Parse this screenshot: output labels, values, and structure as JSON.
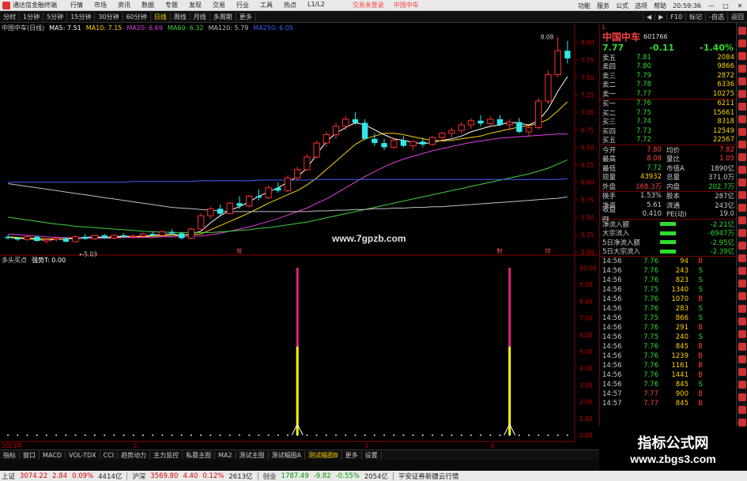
{
  "title_bar": {
    "app_name": "通达信金融终端",
    "menu": [
      "行情",
      "市场",
      "资讯",
      "数据",
      "专题",
      "发现",
      "交易",
      "行业",
      "工具",
      "热点",
      "L1/L2"
    ],
    "trade_text": "交易未登录",
    "stock_text": "中国中车",
    "right_menu": [
      "功能",
      "服务",
      "公式",
      "选项",
      "帮助"
    ],
    "time": "20:59:36",
    "win_buttons": [
      "—",
      "□",
      "✕"
    ]
  },
  "toolbar": {
    "periods": [
      "分时",
      "1分钟",
      "5分钟",
      "15分钟",
      "30分钟",
      "60分钟",
      "日线",
      "周线",
      "月线",
      "多周期",
      "更多"
    ],
    "active_period": "日线",
    "tools": [
      "◀",
      "▶",
      "F10",
      "标记",
      "-自选",
      "返回"
    ]
  },
  "indicators": {
    "main": [
      {
        "label": "中国中车(日线)",
        "color": "#cccccc"
      },
      {
        "label": "MA5: 7.51",
        "color": "#ffffff"
      },
      {
        "label": "MA10: 7.15",
        "color": "#ffd200"
      },
      {
        "label": "MA20: 6.69",
        "color": "#e040e0"
      },
      {
        "label": "MA60: 6.32",
        "color": "#40d040"
      },
      {
        "label": "MA120: 5.79",
        "color": "#c0c0c0"
      },
      {
        "label": "MA250: 6.05",
        "color": "#4060ff"
      }
    ],
    "sub": [
      {
        "label": "多头买点",
        "color": "#cccccc"
      },
      {
        "label": "强势T: 0.00",
        "color": "#ffffff"
      }
    ]
  },
  "watermark": "www.7gpzb.com",
  "chart_data": [
    {
      "type": "candlestick",
      "title": "中国中车(日线)",
      "price_axis_ticks": [
        8.0,
        7.75,
        7.5,
        7.25,
        7.0,
        6.75,
        6.5,
        6.25,
        6.0,
        5.75,
        5.5,
        5.25,
        5.0
      ],
      "ylim": [
        4.98,
        8.12
      ],
      "max_label": "8.08",
      "min_label": "5.03",
      "markers": [
        "增",
        "制",
        "持"
      ],
      "series": [
        {
          "name": "MA5",
          "color": "#ffffff",
          "values": [
            5.21,
            5.2,
            5.19,
            5.18,
            5.17,
            5.18,
            5.19,
            5.2,
            5.21,
            5.22,
            5.21,
            5.22,
            5.23,
            5.22,
            5.23,
            5.24,
            5.25,
            5.26,
            5.24,
            5.26,
            5.3,
            5.42,
            5.52,
            5.6,
            5.65,
            5.72,
            5.8,
            5.86,
            5.92,
            6.0,
            6.08,
            6.2,
            6.4,
            6.58,
            6.7,
            6.78,
            6.85,
            6.82,
            6.75,
            6.68,
            6.62,
            6.6,
            6.57,
            6.55,
            6.57,
            6.6,
            6.62,
            6.66,
            6.72,
            6.76,
            6.8,
            6.82,
            6.86,
            6.84,
            6.82,
            6.88,
            7.05,
            7.3,
            7.51
          ]
        },
        {
          "name": "MA10",
          "color": "#ffd200",
          "values": [
            5.22,
            5.21,
            5.2,
            5.2,
            5.19,
            5.19,
            5.19,
            5.19,
            5.2,
            5.2,
            5.21,
            5.21,
            5.22,
            5.22,
            5.22,
            5.23,
            5.23,
            5.24,
            5.24,
            5.25,
            5.26,
            5.32,
            5.38,
            5.44,
            5.5,
            5.56,
            5.63,
            5.7,
            5.76,
            5.82,
            5.88,
            5.96,
            6.06,
            6.18,
            6.3,
            6.42,
            6.54,
            6.62,
            6.66,
            6.7,
            6.7,
            6.68,
            6.65,
            6.62,
            6.6,
            6.59,
            6.6,
            6.62,
            6.64,
            6.66,
            6.7,
            6.73,
            6.76,
            6.79,
            6.81,
            6.84,
            6.9,
            7.02,
            7.15
          ]
        },
        {
          "name": "MA20",
          "color": "#e040e0",
          "values": [
            5.26,
            5.25,
            5.24,
            5.23,
            5.22,
            5.21,
            5.21,
            5.2,
            5.2,
            5.2,
            5.2,
            5.2,
            5.21,
            5.21,
            5.21,
            5.21,
            5.22,
            5.22,
            5.22,
            5.23,
            5.23,
            5.25,
            5.27,
            5.3,
            5.33,
            5.36,
            5.4,
            5.44,
            5.48,
            5.53,
            5.58,
            5.63,
            5.7,
            5.76,
            5.84,
            5.92,
            6.0,
            6.08,
            6.15,
            6.22,
            6.28,
            6.33,
            6.37,
            6.41,
            6.45,
            6.48,
            6.51,
            6.54,
            6.57,
            6.59,
            6.61,
            6.63,
            6.64,
            6.65,
            6.66,
            6.67,
            6.68,
            6.69,
            6.69
          ]
        },
        {
          "name": "MA60",
          "color": "#40d040",
          "values": [
            5.5,
            5.48,
            5.46,
            5.44,
            5.42,
            5.4,
            5.39,
            5.37,
            5.36,
            5.35,
            5.34,
            5.33,
            5.32,
            5.31,
            5.3,
            5.29,
            5.29,
            5.28,
            5.28,
            5.28,
            5.28,
            5.28,
            5.29,
            5.3,
            5.31,
            5.32,
            5.34,
            5.35,
            5.37,
            5.39,
            5.41,
            5.43,
            5.46,
            5.49,
            5.52,
            5.55,
            5.58,
            5.61,
            5.64,
            5.67,
            5.7,
            5.73,
            5.76,
            5.79,
            5.82,
            5.85,
            5.88,
            5.91,
            5.94,
            5.97,
            6.0,
            6.03,
            6.06,
            6.09,
            6.12,
            6.16,
            6.2,
            6.26,
            6.32
          ]
        },
        {
          "name": "MA120",
          "color": "#c0c0c0",
          "values": [
            5.98,
            5.96,
            5.94,
            5.92,
            5.9,
            5.88,
            5.86,
            5.84,
            5.82,
            5.8,
            5.78,
            5.76,
            5.74,
            5.72,
            5.7,
            5.68,
            5.66,
            5.64,
            5.63,
            5.62,
            5.61,
            5.6,
            5.59,
            5.58,
            5.58,
            5.58,
            5.58,
            5.58,
            5.58,
            5.58,
            5.58,
            5.58,
            5.59,
            5.59,
            5.6,
            5.6,
            5.61,
            5.61,
            5.62,
            5.62,
            5.63,
            5.63,
            5.64,
            5.64,
            5.65,
            5.65,
            5.66,
            5.67,
            5.68,
            5.69,
            5.7,
            5.71,
            5.72,
            5.73,
            5.74,
            5.75,
            5.76,
            5.77,
            5.79
          ]
        },
        {
          "name": "MA250",
          "color": "#4060ff",
          "values": [
            6.0,
            6.0,
            6.0,
            6.0,
            6.0,
            6.0,
            6.0,
            6.0,
            6.0,
            6.0,
            6.0,
            6.0,
            6.0,
            6.01,
            6.01,
            6.01,
            6.01,
            6.01,
            6.01,
            6.01,
            6.02,
            6.02,
            6.02,
            6.02,
            6.02,
            6.02,
            6.03,
            6.03,
            6.03,
            6.03,
            6.03,
            6.03,
            6.04,
            6.04,
            6.04,
            6.04,
            6.04,
            6.04,
            6.04,
            6.04,
            6.04,
            6.04,
            6.04,
            6.04,
            6.04,
            6.04,
            6.04,
            6.04,
            6.04,
            6.04,
            6.04,
            6.04,
            6.04,
            6.04,
            6.04,
            6.04,
            6.04,
            6.04,
            6.05
          ]
        }
      ],
      "candles": [
        [
          5.22,
          5.25,
          5.18,
          5.2
        ],
        [
          5.2,
          5.22,
          5.16,
          5.18
        ],
        [
          5.18,
          5.24,
          5.16,
          5.22
        ],
        [
          5.22,
          5.23,
          5.15,
          5.16
        ],
        [
          5.16,
          5.2,
          5.12,
          5.18
        ],
        [
          5.18,
          5.22,
          5.15,
          5.2
        ],
        [
          5.2,
          5.21,
          5.14,
          5.15
        ],
        [
          5.15,
          5.24,
          5.14,
          5.22
        ],
        [
          5.22,
          5.26,
          5.18,
          5.19
        ],
        [
          5.19,
          5.25,
          5.17,
          5.24
        ],
        [
          5.24,
          5.26,
          5.19,
          5.2
        ],
        [
          5.2,
          5.26,
          5.18,
          5.24
        ],
        [
          5.24,
          5.27,
          5.2,
          5.22
        ],
        [
          5.22,
          5.25,
          5.19,
          5.23
        ],
        [
          5.23,
          5.28,
          5.21,
          5.26
        ],
        [
          5.26,
          5.3,
          5.22,
          5.24
        ],
        [
          5.24,
          5.31,
          5.22,
          5.29
        ],
        [
          5.29,
          5.33,
          5.25,
          5.27
        ],
        [
          5.27,
          5.29,
          5.18,
          5.2
        ],
        [
          5.2,
          5.35,
          5.19,
          5.33
        ],
        [
          5.33,
          5.55,
          5.32,
          5.52
        ],
        [
          5.52,
          5.65,
          5.48,
          5.62
        ],
        [
          5.62,
          5.68,
          5.52,
          5.55
        ],
        [
          5.55,
          5.72,
          5.54,
          5.7
        ],
        [
          5.7,
          5.8,
          5.62,
          5.66
        ],
        [
          5.66,
          5.82,
          5.64,
          5.8
        ],
        [
          5.8,
          5.9,
          5.74,
          5.78
        ],
        [
          5.78,
          5.95,
          5.76,
          5.92
        ],
        [
          5.92,
          6.0,
          5.85,
          5.88
        ],
        [
          5.88,
          6.1,
          5.86,
          6.06
        ],
        [
          6.06,
          6.22,
          6.02,
          6.18
        ],
        [
          6.18,
          6.4,
          6.16,
          6.36
        ],
        [
          6.36,
          6.6,
          6.34,
          6.56
        ],
        [
          6.56,
          6.72,
          6.5,
          6.68
        ],
        [
          6.68,
          6.85,
          6.62,
          6.8
        ],
        [
          6.8,
          6.95,
          6.74,
          6.9
        ],
        [
          6.9,
          7.0,
          6.82,
          6.85
        ],
        [
          6.85,
          6.9,
          6.6,
          6.62
        ],
        [
          6.62,
          6.7,
          6.52,
          6.56
        ],
        [
          6.56,
          6.62,
          6.46,
          6.5
        ],
        [
          6.5,
          6.64,
          6.48,
          6.6
        ],
        [
          6.6,
          6.66,
          6.5,
          6.52
        ],
        [
          6.52,
          6.6,
          6.46,
          6.58
        ],
        [
          6.58,
          6.64,
          6.5,
          6.54
        ],
        [
          6.54,
          6.66,
          6.52,
          6.64
        ],
        [
          6.64,
          6.72,
          6.58,
          6.7
        ],
        [
          6.7,
          6.78,
          6.64,
          6.74
        ],
        [
          6.74,
          6.86,
          6.7,
          6.82
        ],
        [
          6.82,
          6.92,
          6.76,
          6.88
        ],
        [
          6.88,
          6.96,
          6.8,
          6.84
        ],
        [
          6.84,
          6.94,
          6.78,
          6.9
        ],
        [
          6.9,
          6.96,
          6.8,
          6.82
        ],
        [
          6.82,
          6.9,
          6.74,
          6.86
        ],
        [
          6.86,
          6.92,
          6.7,
          6.72
        ],
        [
          6.72,
          6.8,
          6.66,
          6.78
        ],
        [
          6.78,
          7.2,
          6.76,
          7.16
        ],
        [
          7.16,
          7.6,
          7.12,
          7.54
        ],
        [
          7.54,
          8.08,
          7.5,
          7.88
        ],
        [
          7.88,
          8.02,
          7.7,
          7.77
        ]
      ]
    },
    {
      "type": "bar",
      "title": "多头买点",
      "yaxis_ticks": [
        10.0,
        9.0,
        8.0,
        7.0,
        6.0,
        5.0,
        4.0,
        3.0,
        2.0,
        1.0,
        0.0
      ],
      "ylim": [
        0,
        10
      ],
      "date_label": "2023年",
      "date_ticks": [
        "2",
        "3",
        "4"
      ],
      "signals": [
        {
          "index": 30,
          "upper": 10.0,
          "lower": 5.3
        },
        {
          "index": 52,
          "upper": 10.0,
          "lower": 5.3
        }
      ]
    }
  ],
  "stock_panel": {
    "header_left": "L",
    "name": "中国中车",
    "code": "601766",
    "price": "7.77",
    "change": "-0.11",
    "pct": "-1.40%",
    "asks": [
      {
        "label": "卖五",
        "price": "7.81",
        "vol": "2084"
      },
      {
        "label": "卖四",
        "price": "7.80",
        "vol": "9866"
      },
      {
        "label": "卖三",
        "price": "7.79",
        "vol": "2872"
      },
      {
        "label": "卖二",
        "price": "7.78",
        "vol": "6336"
      },
      {
        "label": "卖一",
        "price": "7.77",
        "vol": "10275"
      }
    ],
    "bids": [
      {
        "label": "买一",
        "price": "7.76",
        "vol": "6211"
      },
      {
        "label": "买二",
        "price": "7.75",
        "vol": "15661"
      },
      {
        "label": "买三",
        "price": "7.74",
        "vol": "8318"
      },
      {
        "label": "买四",
        "price": "7.73",
        "vol": "12549"
      },
      {
        "label": "买五",
        "price": "7.72",
        "vol": "22567"
      }
    ],
    "stats": [
      {
        "k": "今开",
        "v": "7.80",
        "vc": "red",
        "k2": "均价",
        "v2": "7.82",
        "v2c": "red"
      },
      {
        "k": "最高",
        "v": "8.08",
        "vc": "red",
        "k2": "量比",
        "v2": "1.05",
        "v2c": "red"
      },
      {
        "k": "最低",
        "v": "7.72",
        "vc": "grn",
        "k2": "市值A",
        "v2": "1890亿",
        "v2c": ""
      },
      {
        "k": "现量",
        "v": "43932",
        "vc": "yel",
        "k2": "总量",
        "v2": "371.0万",
        "v2c": ""
      },
      {
        "k": "外盘",
        "v": "168.3万",
        "vc": "red",
        "k2": "内盘",
        "v2": "202.7万",
        "v2c": "grn"
      },
      {
        "k": "换手",
        "v": "1.53%",
        "vc": "",
        "k2": "股本",
        "v2": "287亿",
        "v2c": ""
      },
      {
        "k": "净资",
        "v": "5.61",
        "vc": "",
        "k2": "流通",
        "v2": "243亿",
        "v2c": ""
      },
      {
        "k": "收益㈣",
        "v": "0.410",
        "vc": "",
        "k2": "PE(动)",
        "v2": "19.0",
        "v2c": ""
      }
    ],
    "flows": [
      {
        "k": "净流入额",
        "v": "-2.21亿"
      },
      {
        "k": "大宗流入",
        "v": "-6947万"
      },
      {
        "k": "5日净流入额",
        "v": "-2.95亿"
      },
      {
        "k": "5日大宗流入",
        "v": "-2.39亿"
      }
    ],
    "ticks": [
      {
        "t": "14:56",
        "p": "7.76",
        "v": "94",
        "s": "B"
      },
      {
        "t": "14:56",
        "p": "7.76",
        "v": "243",
        "s": "S"
      },
      {
        "t": "14:56",
        "p": "7.76",
        "v": "823",
        "s": "S"
      },
      {
        "t": "14:56",
        "p": "7.75",
        "v": "1340",
        "s": "S"
      },
      {
        "t": "14:56",
        "p": "7.76",
        "v": "1070",
        "s": "B"
      },
      {
        "t": "14:56",
        "p": "7.76",
        "v": "283",
        "s": "S"
      },
      {
        "t": "14:56",
        "p": "7.75",
        "v": "866",
        "s": "S"
      },
      {
        "t": "14:56",
        "p": "7.76",
        "v": "291",
        "s": "B"
      },
      {
        "t": "14:56",
        "p": "7.75",
        "v": "240",
        "s": "S"
      },
      {
        "t": "14:56",
        "p": "7.76",
        "v": "845",
        "s": "B"
      },
      {
        "t": "14:56",
        "p": "7.76",
        "v": "1239",
        "s": "B"
      },
      {
        "t": "14:56",
        "p": "7.76",
        "v": "1161",
        "s": "B"
      },
      {
        "t": "14:56",
        "p": "7.76",
        "v": "1441",
        "s": "B"
      },
      {
        "t": "14:56",
        "p": "7.76",
        "v": "845",
        "s": "S"
      },
      {
        "t": "14:57",
        "p": "7.77",
        "v": "900",
        "s": "B"
      },
      {
        "t": "14:57",
        "p": "7.77",
        "v": "845",
        "s": "B"
      }
    ]
  },
  "bottom_tabs": [
    "指标",
    "窗口",
    "MACD",
    "VOL-TDX",
    "CCI",
    "趋势动力",
    "主力监控",
    "私募主图",
    "MA2",
    "测试主图",
    "测试幅图A",
    "测试幅图B",
    "更多",
    "设置"
  ],
  "bottom_selected": "测试幅图B",
  "banner": {
    "line1": "指标公式网",
    "line2": "www.zbgs3.com"
  },
  "status_bar": [
    {
      "text": "上证",
      "c": ""
    },
    {
      "text": "3074.22",
      "c": "red"
    },
    {
      "text": "2.84",
      "c": "red"
    },
    {
      "text": "0.09%",
      "c": "red"
    },
    {
      "text": "4414亿",
      "c": ""
    },
    {
      "text": "沪深",
      "c": ""
    },
    {
      "text": "3569.80",
      "c": "red"
    },
    {
      "text": "4.40",
      "c": "red"
    },
    {
      "text": "0.12%",
      "c": "red"
    },
    {
      "text": "2613亿",
      "c": ""
    },
    {
      "text": "创业",
      "c": ""
    },
    {
      "text": "1787.49",
      "c": "grn"
    },
    {
      "text": "-9.82",
      "c": "grn"
    },
    {
      "text": "-0.55%",
      "c": "grn"
    },
    {
      "text": "2054亿",
      "c": ""
    },
    {
      "text": "平安证券新疆云行情",
      "c": ""
    }
  ]
}
